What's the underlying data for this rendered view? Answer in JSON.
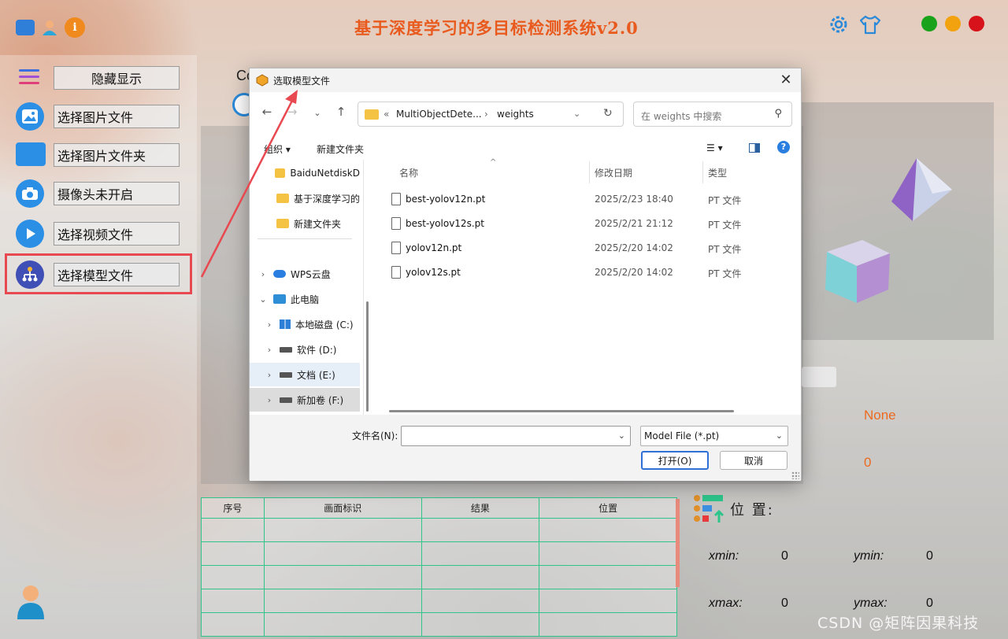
{
  "app": {
    "title": "基于深度学习的多目标检测系统v2.0",
    "colors": {
      "accent": "#e85a1d",
      "win_green": "#1aa31a",
      "win_yellow": "#f2a10f",
      "win_red": "#d8121a",
      "highlight": "#e8484f",
      "table_border": "#2ec58a"
    }
  },
  "sidebar": {
    "toggle_label": "隐藏显示",
    "items": [
      {
        "label": "选择图片文件",
        "icon": "image-icon"
      },
      {
        "label": "选择图片文件夹",
        "icon": "folder-icon"
      },
      {
        "label": "摄像头未开启",
        "icon": "camera-icon"
      },
      {
        "label": "选择视频文件",
        "icon": "play-icon"
      },
      {
        "label": "选择模型文件",
        "icon": "model-icon"
      }
    ]
  },
  "main": {
    "co_label": "Co",
    "none_value": "None",
    "zero_value": "0",
    "table": {
      "headers": [
        "序号",
        "画面标识",
        "结果",
        "位置"
      ],
      "rows": [
        [
          "",
          "",
          "",
          ""
        ],
        [
          "",
          "",
          "",
          ""
        ],
        [
          "",
          "",
          "",
          ""
        ],
        [
          "",
          "",
          "",
          ""
        ],
        [
          "",
          "",
          "",
          ""
        ]
      ]
    },
    "position": {
      "title": "位 置:",
      "xmin_label": "xmin:",
      "xmin": "0",
      "ymin_label": "ymin:",
      "ymin": "0",
      "xmax_label": "xmax:",
      "xmax": "0",
      "ymax_label": "ymax:",
      "ymax": "0"
    },
    "watermark": "CSDN @矩阵因果科技"
  },
  "dialog": {
    "title": "选取模型文件",
    "address": {
      "prefix": "«",
      "segment1": "MultiObjectDete...",
      "separator": "›",
      "segment2": "weights"
    },
    "search_placeholder": "在 weights 中搜索",
    "toolbar": {
      "organize": "组织 ▾",
      "new_folder": "新建文件夹"
    },
    "tree": [
      {
        "label": "BaiduNetdiskD",
        "type": "folder"
      },
      {
        "label": "基于深度学习的",
        "type": "folder"
      },
      {
        "label": "新建文件夹",
        "type": "folder"
      },
      {
        "label": "WPS云盘",
        "type": "cloud"
      },
      {
        "label": "此电脑",
        "type": "pc"
      },
      {
        "label": "本地磁盘 (C:)",
        "type": "drive"
      },
      {
        "label": "软件 (D:)",
        "type": "drive"
      },
      {
        "label": "文档 (E:)",
        "type": "drive"
      },
      {
        "label": "新加卷 (F:)",
        "type": "drive"
      }
    ],
    "columns": {
      "name": "名称",
      "date": "修改日期",
      "type": "类型"
    },
    "files": [
      {
        "name": "best-yolov12n.pt",
        "date": "2025/2/23 18:40",
        "type": "PT 文件"
      },
      {
        "name": "best-yolov12s.pt",
        "date": "2025/2/21 21:12",
        "type": "PT 文件"
      },
      {
        "name": "yolov12n.pt",
        "date": "2025/2/20 14:02",
        "type": "PT 文件"
      },
      {
        "name": "yolov12s.pt",
        "date": "2025/2/20 14:02",
        "type": "PT 文件"
      }
    ],
    "filename_label": "文件名(N):",
    "filename_value": "",
    "filter": "Model File (*.pt)",
    "open_label": "打开(O)",
    "cancel_label": "取消"
  }
}
